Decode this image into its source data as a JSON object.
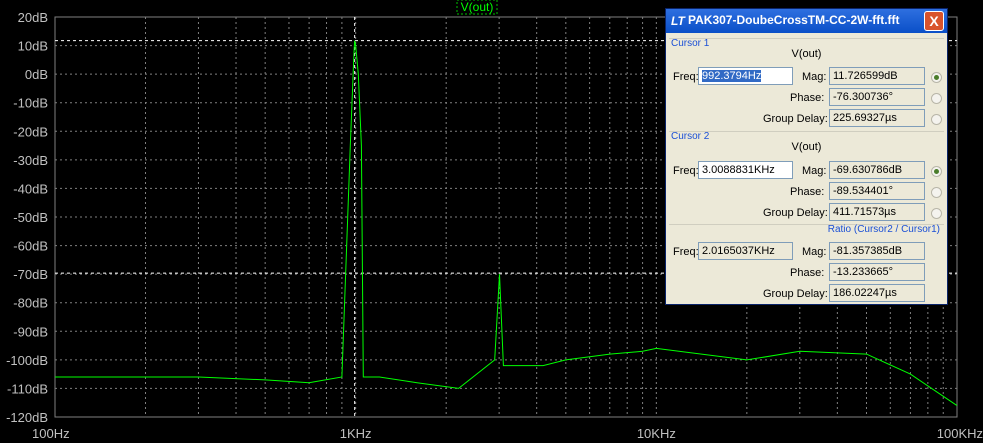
{
  "plot": {
    "trace_label": "V(out)",
    "y_ticks": [
      "20dB",
      "10dB",
      "0dB",
      "-10dB",
      "-20dB",
      "-30dB",
      "-40dB",
      "-50dB",
      "-60dB",
      "-70dB",
      "-80dB",
      "-90dB",
      "-100dB",
      "-110dB",
      "-120dB"
    ],
    "x_ticks": [
      "100Hz",
      "1KHz",
      "10KHz",
      "100KHz"
    ],
    "colors": {
      "background": "#000000",
      "grid": "#808080",
      "trace": "#00ff00",
      "tick_text": "#c0c0c0"
    }
  },
  "chart_data": {
    "type": "line",
    "x_scale": "log",
    "xlim": [
      100,
      100000
    ],
    "ylim": [
      -120,
      20
    ],
    "series": [
      {
        "name": "V(out)",
        "x": [
          100,
          300,
          500,
          700,
          900,
          960,
          985,
          992,
          1000,
          1020,
          1045,
          1060,
          1200,
          1600,
          2200,
          2900,
          3009,
          3100,
          4200,
          5000,
          7000,
          9000,
          10000,
          20000,
          30000,
          50000,
          70000,
          100000
        ],
        "y": [
          -106,
          -106,
          -107,
          -108,
          -106,
          -25,
          5,
          11.7,
          10,
          0,
          -25,
          -106,
          -106,
          -108,
          -110,
          -100,
          -70,
          -102,
          -102,
          -100,
          -98,
          -97,
          -96,
          -100,
          -97,
          -98,
          -105,
          -116
        ]
      }
    ]
  },
  "dialog": {
    "title": "PAK307-DoubeCrossTM-CC-2W-fft.fft",
    "close": "X",
    "cursor1": {
      "group": "Cursor 1",
      "signal": "V(out)",
      "freq_label": "Freq:",
      "freq": "992.3794Hz",
      "mag_label": "Mag:",
      "mag": "11.726599dB",
      "phase_label": "Phase:",
      "phase": "-76.300736°",
      "gd_label": "Group Delay:",
      "gd": "225.69327µs"
    },
    "cursor2": {
      "group": "Cursor 2",
      "signal": "V(out)",
      "freq_label": "Freq:",
      "freq": "3.0088831KHz",
      "mag_label": "Mag:",
      "mag": "-69.630786dB",
      "phase_label": "Phase:",
      "phase": "-89.534401°",
      "gd_label": "Group Delay:",
      "gd": "411.71573µs"
    },
    "ratio": {
      "group": "Ratio (Cursor2 / Cursor1)",
      "freq_label": "Freq:",
      "freq": "2.0165037KHz",
      "mag_label": "Mag:",
      "mag": "-81.357385dB",
      "phase_label": "Phase:",
      "phase": "-13.233665°",
      "gd_label": "Group Delay:",
      "gd": "186.02247µs"
    }
  }
}
